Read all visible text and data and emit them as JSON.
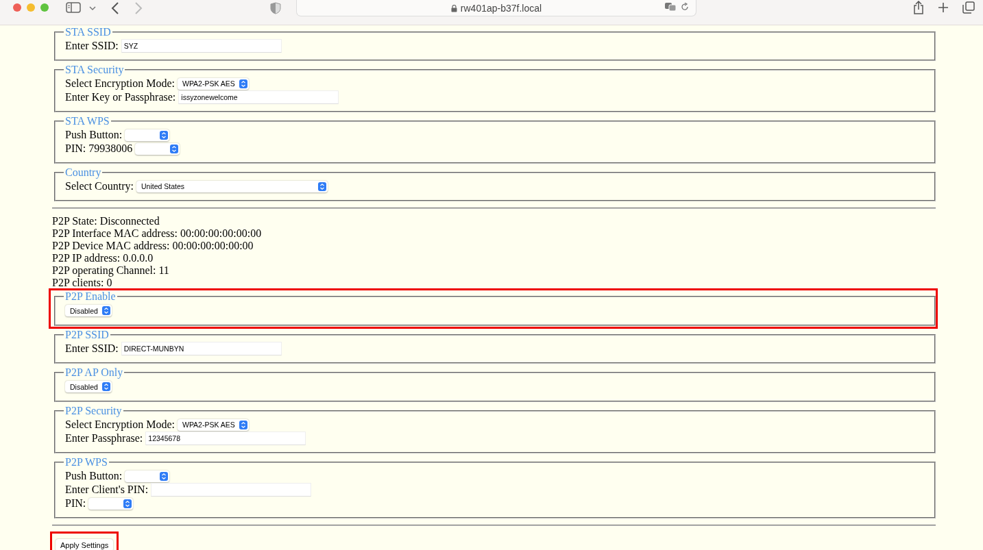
{
  "browser": {
    "url": "rw401ap-b37f.local"
  },
  "sections": [
    {
      "legend": "STA SSID",
      "highlighted": false,
      "rows": [
        {
          "label": "Enter SSID:",
          "field": {
            "kind": "input",
            "value": "SYZ"
          }
        }
      ]
    },
    {
      "legend": "STA Security",
      "highlighted": false,
      "rows": [
        {
          "label": "Select Encryption Mode:",
          "field": {
            "kind": "select",
            "value": "WPA2-PSK AES"
          }
        },
        {
          "label": "Enter Key or Passphrase:",
          "field": {
            "kind": "input",
            "value": "issyzonewelcome"
          }
        }
      ]
    },
    {
      "legend": "STA WPS",
      "highlighted": false,
      "rows": [
        {
          "label": "Push Button:",
          "field": {
            "kind": "select"
          }
        },
        {
          "label": "PIN: 79938006",
          "field": {
            "kind": "select"
          }
        }
      ]
    },
    {
      "legend": "Country",
      "highlighted": false,
      "rows": [
        {
          "label": "Select Country:",
          "field": {
            "kind": "select-wide",
            "value": "United States"
          }
        }
      ]
    }
  ],
  "status_lines": [
    "P2P State: Disconnected",
    "P2P Interface MAC address: 00:00:00:00:00:00",
    "P2P Device MAC address: 00:00:00:00:00:00",
    "P2P IP address: 0.0.0.0",
    "P2P operating Channel: 11",
    "P2P clients: 0"
  ],
  "p2p_sections": [
    {
      "legend": "P2P Enable",
      "highlighted": true,
      "rows": [
        {
          "field": {
            "kind": "select",
            "value": "Disabled"
          }
        }
      ]
    },
    {
      "legend": "P2P SSID",
      "highlighted": false,
      "rows": [
        {
          "label": "Enter SSID:",
          "field": {
            "kind": "input",
            "value": "DIRECT-MUNBYN"
          }
        }
      ]
    },
    {
      "legend": "P2P AP Only",
      "highlighted": false,
      "rows": [
        {
          "field": {
            "kind": "select",
            "value": "Disabled"
          }
        }
      ]
    },
    {
      "legend": "P2P Security",
      "highlighted": false,
      "rows": [
        {
          "label": "Select Encryption Mode:",
          "field": {
            "kind": "select",
            "value": "WPA2-PSK AES"
          }
        },
        {
          "label": "Enter Passphrase:",
          "field": {
            "kind": "input",
            "value": "12345678"
          }
        }
      ]
    },
    {
      "legend": "P2P WPS",
      "highlighted": false,
      "rows": [
        {
          "label": "Push Button:",
          "field": {
            "kind": "select"
          }
        },
        {
          "label": "Enter Client's PIN:",
          "field": {
            "kind": "input"
          }
        },
        {
          "label": "PIN:",
          "field": {
            "kind": "select"
          }
        }
      ]
    }
  ],
  "apply_button": {
    "label": "Apply Settings",
    "highlighted": true
  }
}
